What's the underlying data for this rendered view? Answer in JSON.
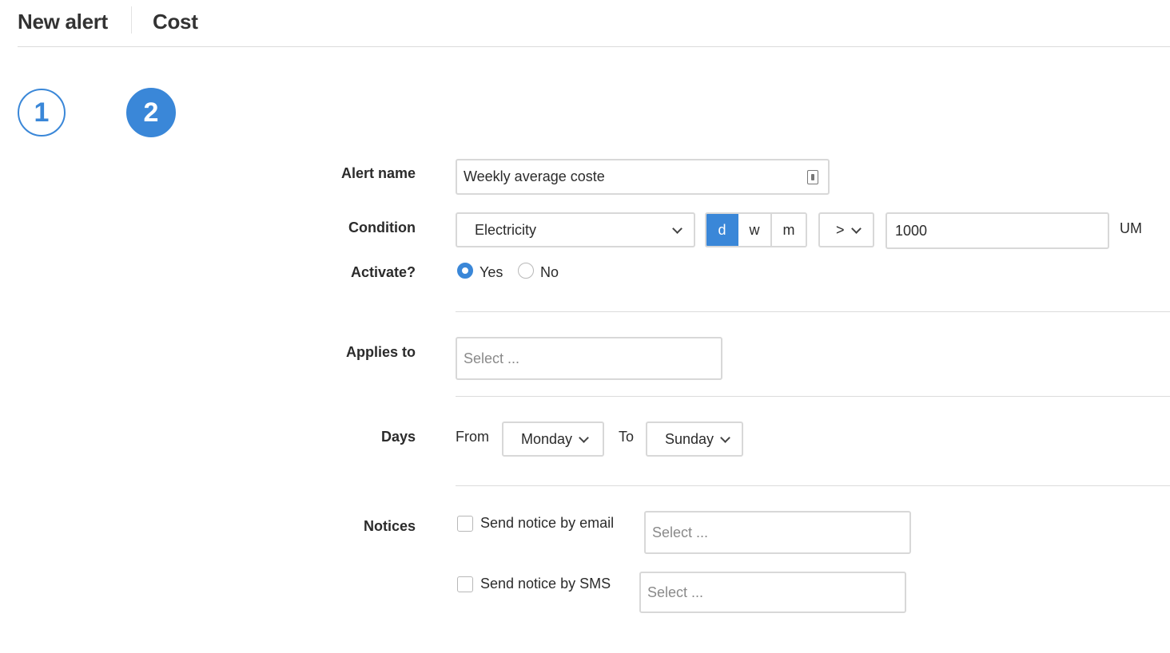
{
  "header": {
    "breadcrumb_parent": "New alert",
    "page_title": "Cost"
  },
  "steps": [
    {
      "number": "1",
      "state": "completed"
    },
    {
      "number": "2",
      "state": "active"
    }
  ],
  "form": {
    "alert_name": {
      "label": "Alert name",
      "value": "Weekly average coste"
    },
    "condition": {
      "label": "Condition",
      "metric": "Electricity",
      "period_options": [
        "d",
        "w",
        "m"
      ],
      "period_selected": "d",
      "operator": ">",
      "threshold": "1000",
      "unit": "UM"
    },
    "activate": {
      "label": "Activate?",
      "options": [
        "Yes",
        "No"
      ],
      "selected": "Yes"
    },
    "applies_to": {
      "label": "Applies to",
      "placeholder": "Select ..."
    },
    "days": {
      "label": "Days",
      "from_label": "From",
      "from_value": "Monday",
      "to_label": "To",
      "to_value": "Sunday"
    },
    "notices": {
      "label": "Notices",
      "email_label": "Send notice by email",
      "email_placeholder": "Select ...",
      "sms_label": "Send notice by SMS",
      "sms_placeholder": "Select ..."
    }
  },
  "colors": {
    "accent": "#3a87d8",
    "border": "#d8d8d8"
  }
}
